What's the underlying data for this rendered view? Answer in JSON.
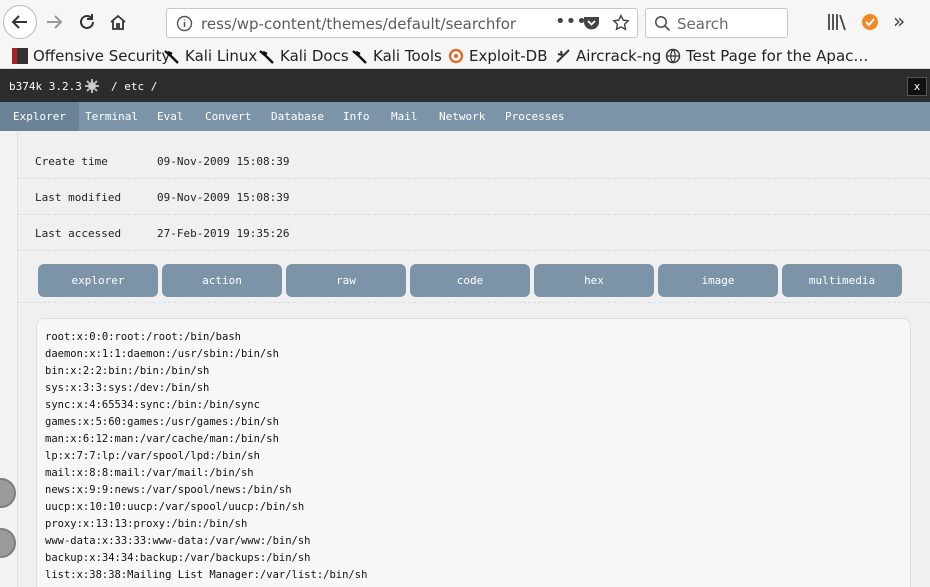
{
  "browser": {
    "url": "ress/wp-content/themes/default/searchform.php",
    "search_placeholder": "Search",
    "bookmarks": [
      {
        "label": "Offensive Security",
        "icon": "offsec-icon"
      },
      {
        "label": "Kali Linux",
        "icon": "kali-dragon-icon"
      },
      {
        "label": "Kali Docs",
        "icon": "kali-dragon-icon"
      },
      {
        "label": "Kali Tools",
        "icon": "kali-dragon-icon"
      },
      {
        "label": "Exploit-DB",
        "icon": "exploitdb-icon"
      },
      {
        "label": "Aircrack-ng",
        "icon": "aircrack-icon"
      },
      {
        "label": "Test Page for the Apac…",
        "icon": "globe-icon"
      }
    ]
  },
  "shell": {
    "title": "b374k 3.2.3",
    "path": "/ etc /",
    "close_label": "x"
  },
  "menu": [
    "Explorer",
    "Terminal",
    "Eval",
    "Convert",
    "Database",
    "Info",
    "Mail",
    "Network",
    "Processes"
  ],
  "info": [
    {
      "label": "Create time",
      "value": "09-Nov-2009 15:08:39"
    },
    {
      "label": "Last modified",
      "value": "09-Nov-2009 15:08:39"
    },
    {
      "label": "Last accessed",
      "value": "27-Feb-2019 19:35:26"
    }
  ],
  "actions": [
    "explorer",
    "action",
    "raw",
    "code",
    "hex",
    "image",
    "multimedia"
  ],
  "file_lines": [
    "root:x:0:0:root:/root:/bin/bash",
    "daemon:x:1:1:daemon:/usr/sbin:/bin/sh",
    "bin:x:2:2:bin:/bin:/bin/sh",
    "sys:x:3:3:sys:/dev:/bin/sh",
    "sync:x:4:65534:sync:/bin:/bin/sync",
    "games:x:5:60:games:/usr/games:/bin/sh",
    "man:x:6:12:man:/var/cache/man:/bin/sh",
    "lp:x:7:7:lp:/var/spool/lpd:/bin/sh",
    "mail:x:8:8:mail:/var/mail:/bin/sh",
    "news:x:9:9:news:/var/spool/news:/bin/sh",
    "uucp:x:10:10:uucp:/var/spool/uucp:/bin/sh",
    "proxy:x:13:13:proxy:/bin:/bin/sh",
    "www-data:x:33:33:www-data:/var/www:/bin/sh",
    "backup:x:34:34:backup:/var/backups:/bin/sh",
    "list:x:38:38:Mailing List Manager:/var/list:/bin/sh"
  ]
}
